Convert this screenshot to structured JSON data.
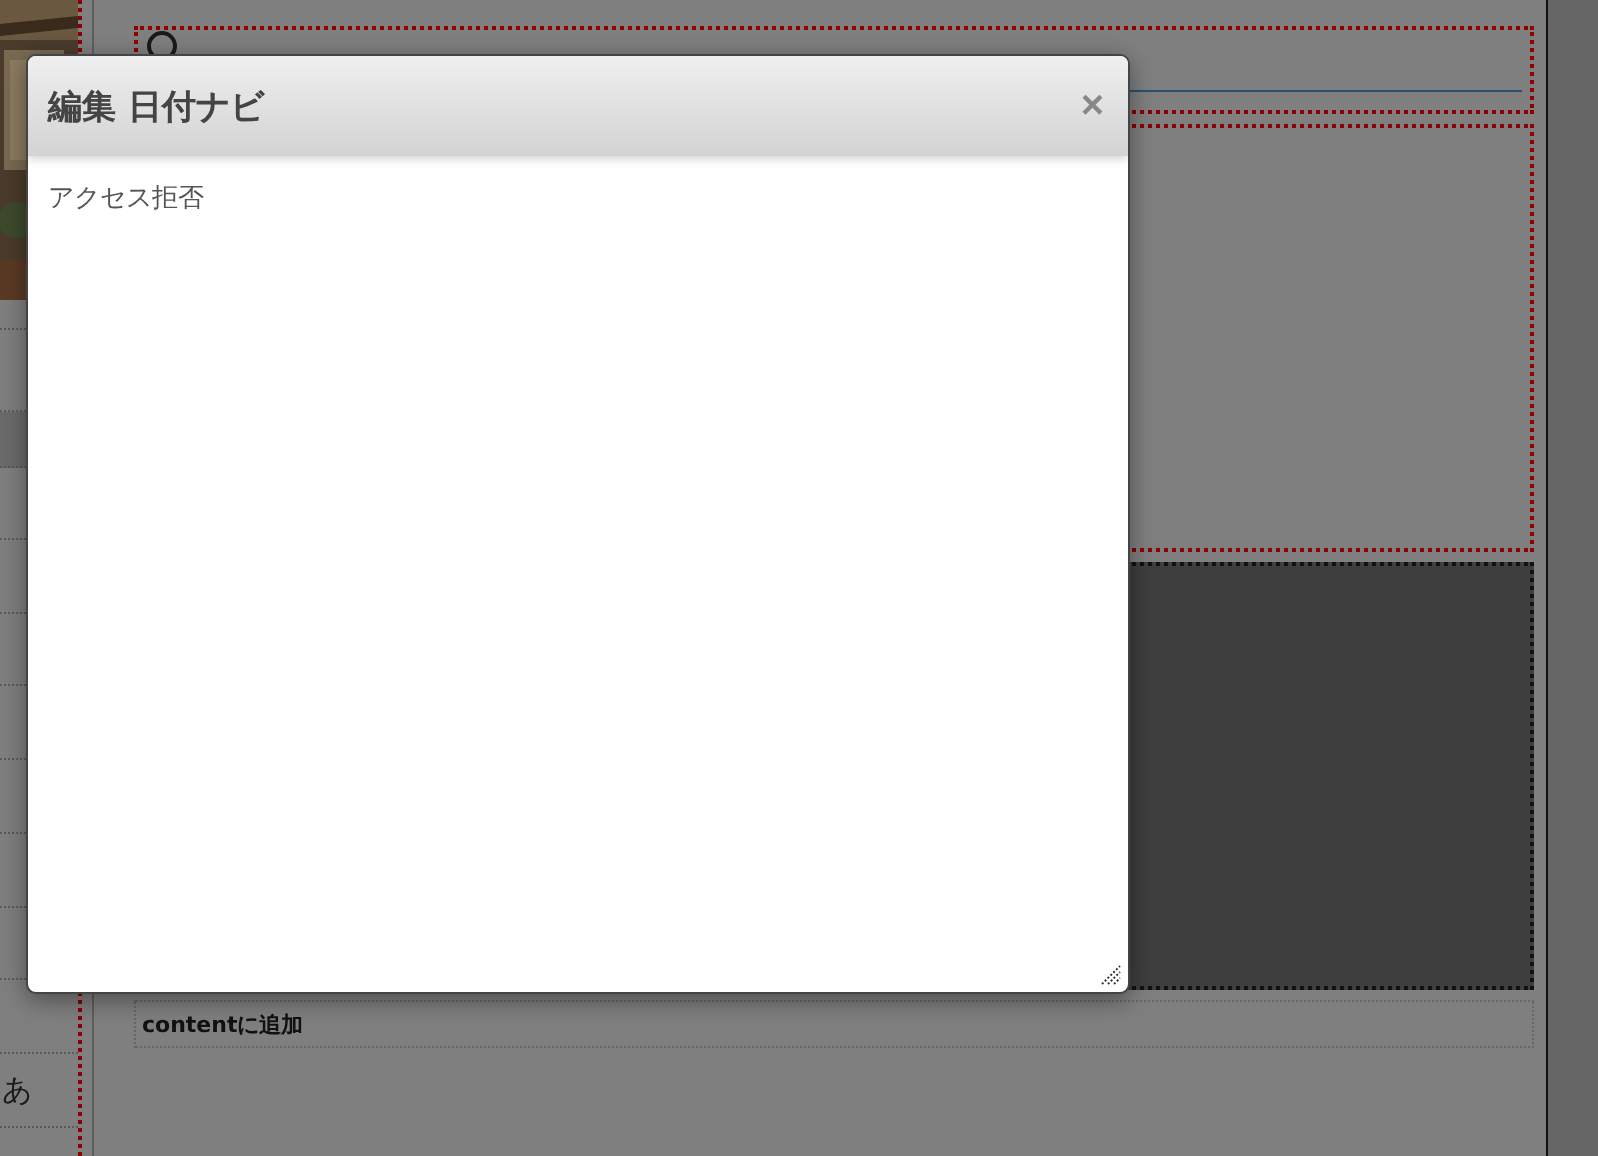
{
  "page": {
    "sidebar_text": "あ",
    "add_content_link": "contentに追加"
  },
  "dialog": {
    "title": "編集 日付ナビ",
    "close": "×",
    "message": "アクセス拒否"
  }
}
